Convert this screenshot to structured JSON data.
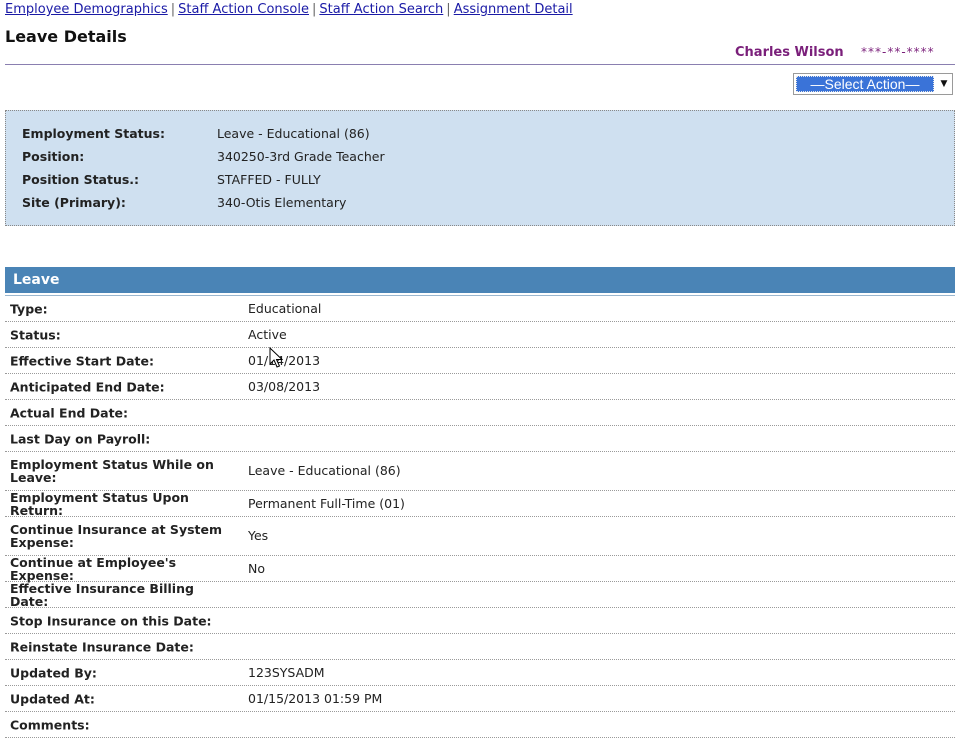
{
  "nav": {
    "links": [
      "Employee Demographics",
      "Staff Action Console",
      "Staff Action Search",
      "Assignment Detail"
    ],
    "separator": "|"
  },
  "page": {
    "title": "Leave Details"
  },
  "user": {
    "name": "Charles Wilson",
    "ssn": "***-**-****"
  },
  "action_select": {
    "selected": "—Select Action—",
    "arrow_icon": "chevron-down-icon"
  },
  "summary": {
    "rows": [
      {
        "label": "Employment Status:",
        "value": "Leave - Educational (86)"
      },
      {
        "label": "Position:",
        "value": "340250-3rd Grade Teacher"
      },
      {
        "label": "Position Status.:",
        "value": "STAFFED - FULLY"
      },
      {
        "label": "Site (Primary):",
        "value": "340-Otis Elementary"
      }
    ]
  },
  "leave": {
    "header": "Leave",
    "rows": [
      {
        "label": "Type:",
        "value": "Educational"
      },
      {
        "label": "Status:",
        "value": "Active"
      },
      {
        "label": "Effective Start Date:",
        "value": "01/14/2013"
      },
      {
        "label": "Anticipated End Date:",
        "value": "03/08/2013"
      },
      {
        "label": "Actual End Date:",
        "value": ""
      },
      {
        "label": "Last Day on Payroll:",
        "value": ""
      },
      {
        "label": "Employment Status While on Leave:",
        "value": "Leave - Educational (86)"
      },
      {
        "label": "Employment Status Upon Return:",
        "value": "Permanent Full-Time (01)"
      },
      {
        "label": "Continue Insurance at System Expense:",
        "value": "Yes"
      },
      {
        "label": "Continue at Employee's Expense:",
        "value": "No"
      },
      {
        "label": "Effective Insurance Billing Date:",
        "value": ""
      },
      {
        "label": "Stop Insurance on this Date:",
        "value": ""
      },
      {
        "label": "Reinstate Insurance Date:",
        "value": ""
      },
      {
        "label": "Updated By:",
        "value": "123SYSADM"
      },
      {
        "label": "Updated At:",
        "value": "01/15/2013 01:59 PM"
      },
      {
        "label": "Comments:",
        "value": ""
      }
    ]
  },
  "colors": {
    "link": "#1a1aa6",
    "user_name": "#7a1f7a",
    "summary_bg": "#cfe0f0",
    "section_header_bg": "#4a84b6",
    "select_highlight": "#3a73d8"
  }
}
